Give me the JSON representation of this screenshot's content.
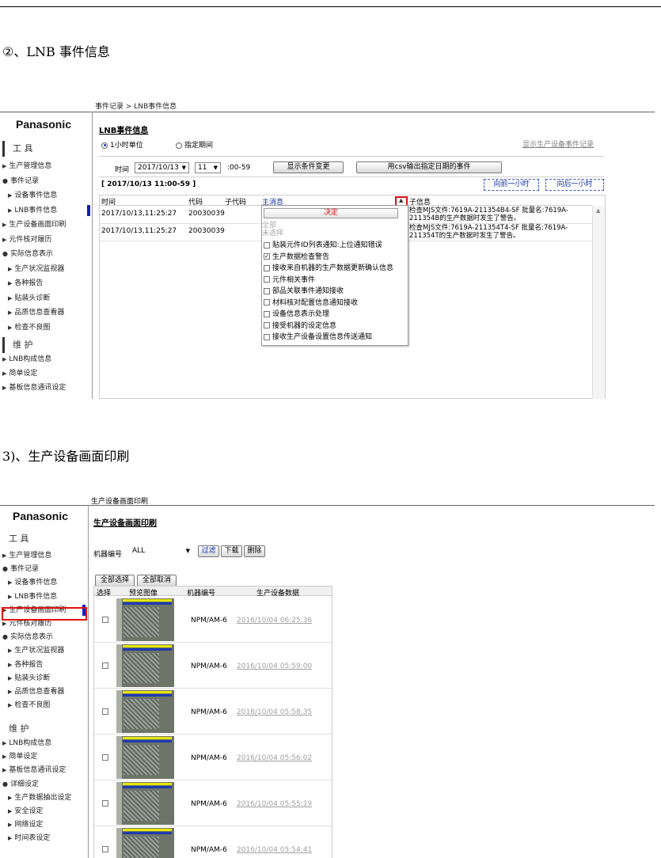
{
  "doc": {
    "heading1": "②、LNB 事件信息",
    "heading2": "3)、生产设备画面印刷"
  },
  "shot1": {
    "breadcrumb": "事件记录 > LNB事件信息",
    "logo": "Panasonic",
    "sidebar": {
      "group_tools": "工 具",
      "items": [
        {
          "label": "生产管理信息",
          "kind": "tri"
        },
        {
          "label": "事件记录",
          "kind": "dot"
        },
        {
          "label": "设备事件信息",
          "kind": "sub"
        },
        {
          "label": "LNB事件信息",
          "kind": "sub",
          "selected": true
        },
        {
          "label": "生产设备画面印刷",
          "kind": "tri"
        },
        {
          "label": "元件核对履历",
          "kind": "tri"
        },
        {
          "label": "实际信息表示",
          "kind": "dot"
        },
        {
          "label": "生产状况监视器",
          "kind": "sub"
        },
        {
          "label": "各种报告",
          "kind": "sub"
        },
        {
          "label": "贴装头诊断",
          "kind": "sub"
        },
        {
          "label": "品质信息查看器",
          "kind": "sub"
        },
        {
          "label": "检查不良图",
          "kind": "sub"
        }
      ],
      "group_maint": "维 护",
      "items2": [
        {
          "label": "LNB构成信息"
        },
        {
          "label": "简单设定"
        },
        {
          "label": "基板信息通讯设定"
        }
      ]
    },
    "page_title": "LNB事件信息",
    "radio_hourly": "1小时单位",
    "radio_period": "指定期间",
    "right_link": "显示生产设备事件记录",
    "time_label": "时间",
    "date_value": "2017/10/13",
    "hour_value": "11",
    "minute_range": ":00-59",
    "btn_change": "显示条件变更",
    "btn_csv": "用csv输出指定日期的事件",
    "range_title": "[ 2017/10/13 11:00-59 ]",
    "btn_prev": "向前一小时",
    "btn_next": "向后一小时",
    "table": {
      "headers": [
        "时间",
        "代码",
        "子代码",
        "主消息",
        "子信息"
      ],
      "rows": [
        {
          "time": "2017/10/13,11:25:27",
          "code": "20030039",
          "info": "检查MJS文件:7619A-211354B4-SF 批量名:7619A-211354B的生产数据时发生了警告。"
        },
        {
          "time": "2017/10/13,11:25:27",
          "code": "20030039",
          "info": "检查MJS文件:7619A-211354T4-SF 批量名:7619A-211354T的生产数据时发生了警告。"
        }
      ]
    },
    "dropdown": {
      "decide": "决定",
      "select_all": "全部",
      "unselect": "未选择",
      "options": [
        {
          "label": "贴装元件ID列表通知:上位通知错误",
          "checked": false
        },
        {
          "label": "生产数据检查警告",
          "checked": true
        },
        {
          "label": "接收来自机器的生产数据更新确认信息",
          "checked": false
        },
        {
          "label": "元件相关事件",
          "checked": false
        },
        {
          "label": "部品关联事件通知接收",
          "checked": false
        },
        {
          "label": "材料核对配置信息通知接收",
          "checked": false
        },
        {
          "label": "设备信息表示处理",
          "checked": false
        },
        {
          "label": "接受机器的设定信息",
          "checked": false
        },
        {
          "label": "接收生产设备设置信息传送通知",
          "checked": false
        }
      ]
    }
  },
  "shot2": {
    "breadcrumb": "生产设备画面印刷",
    "logo": "Panasonic",
    "sidebar": {
      "group_tools": "工 具",
      "items": [
        {
          "label": "生产管理信息",
          "kind": "tri"
        },
        {
          "label": "事件记录",
          "kind": "dot"
        },
        {
          "label": "设备事件信息",
          "kind": "sub"
        },
        {
          "label": "LNB事件信息",
          "kind": "sub"
        },
        {
          "label": "生产设备画面印刷",
          "kind": "tri",
          "selected": true
        },
        {
          "label": "元件核对履历",
          "kind": "tri"
        },
        {
          "label": "实际信息表示",
          "kind": "dot"
        },
        {
          "label": "生产状况监视器",
          "kind": "sub"
        },
        {
          "label": "各种报告",
          "kind": "sub"
        },
        {
          "label": "贴装头诊断",
          "kind": "sub"
        },
        {
          "label": "品质信息查看器",
          "kind": "sub"
        },
        {
          "label": "检查不良图",
          "kind": "sub"
        }
      ],
      "group_maint": "维 护",
      "items2": [
        {
          "label": "LNB构成信息",
          "kind": "tri"
        },
        {
          "label": "简单设定",
          "kind": "tri"
        },
        {
          "label": "基板信息通讯设定",
          "kind": "tri"
        },
        {
          "label": "详细设定",
          "kind": "dot"
        },
        {
          "label": "生产数据抽出设定",
          "kind": "sub"
        },
        {
          "label": "安全设定",
          "kind": "sub"
        },
        {
          "label": "网络设定",
          "kind": "sub"
        },
        {
          "label": "时间表设定",
          "kind": "sub"
        }
      ]
    },
    "page_title": "生产设备画面印刷",
    "machine_label": "机器编号",
    "machine_value": "ALL",
    "btn_filter": "过滤",
    "btn_download": "下载",
    "btn_delete": "删除",
    "btn_select_all": "全部选择",
    "btn_clear_all": "全部取消",
    "table": {
      "headers": [
        "选择",
        "预览图像",
        "机器编号",
        "生产设备数据"
      ],
      "rows": [
        {
          "machine": "NPM/AM-6",
          "data": "2016/10/04 06:25:36"
        },
        {
          "machine": "NPM/AM-6",
          "data": "2016/10/04 05:59:00"
        },
        {
          "machine": "NPM/AM-6",
          "data": "2016/10/04 05:58:35"
        },
        {
          "machine": "NPM/AM-6",
          "data": "2016/10/04 05:56:02"
        },
        {
          "machine": "NPM/AM-6",
          "data": "2016/10/04 05:55:19"
        },
        {
          "machine": "NPM/AM-6",
          "data": "2016/10/04 05:54:41"
        }
      ]
    }
  }
}
